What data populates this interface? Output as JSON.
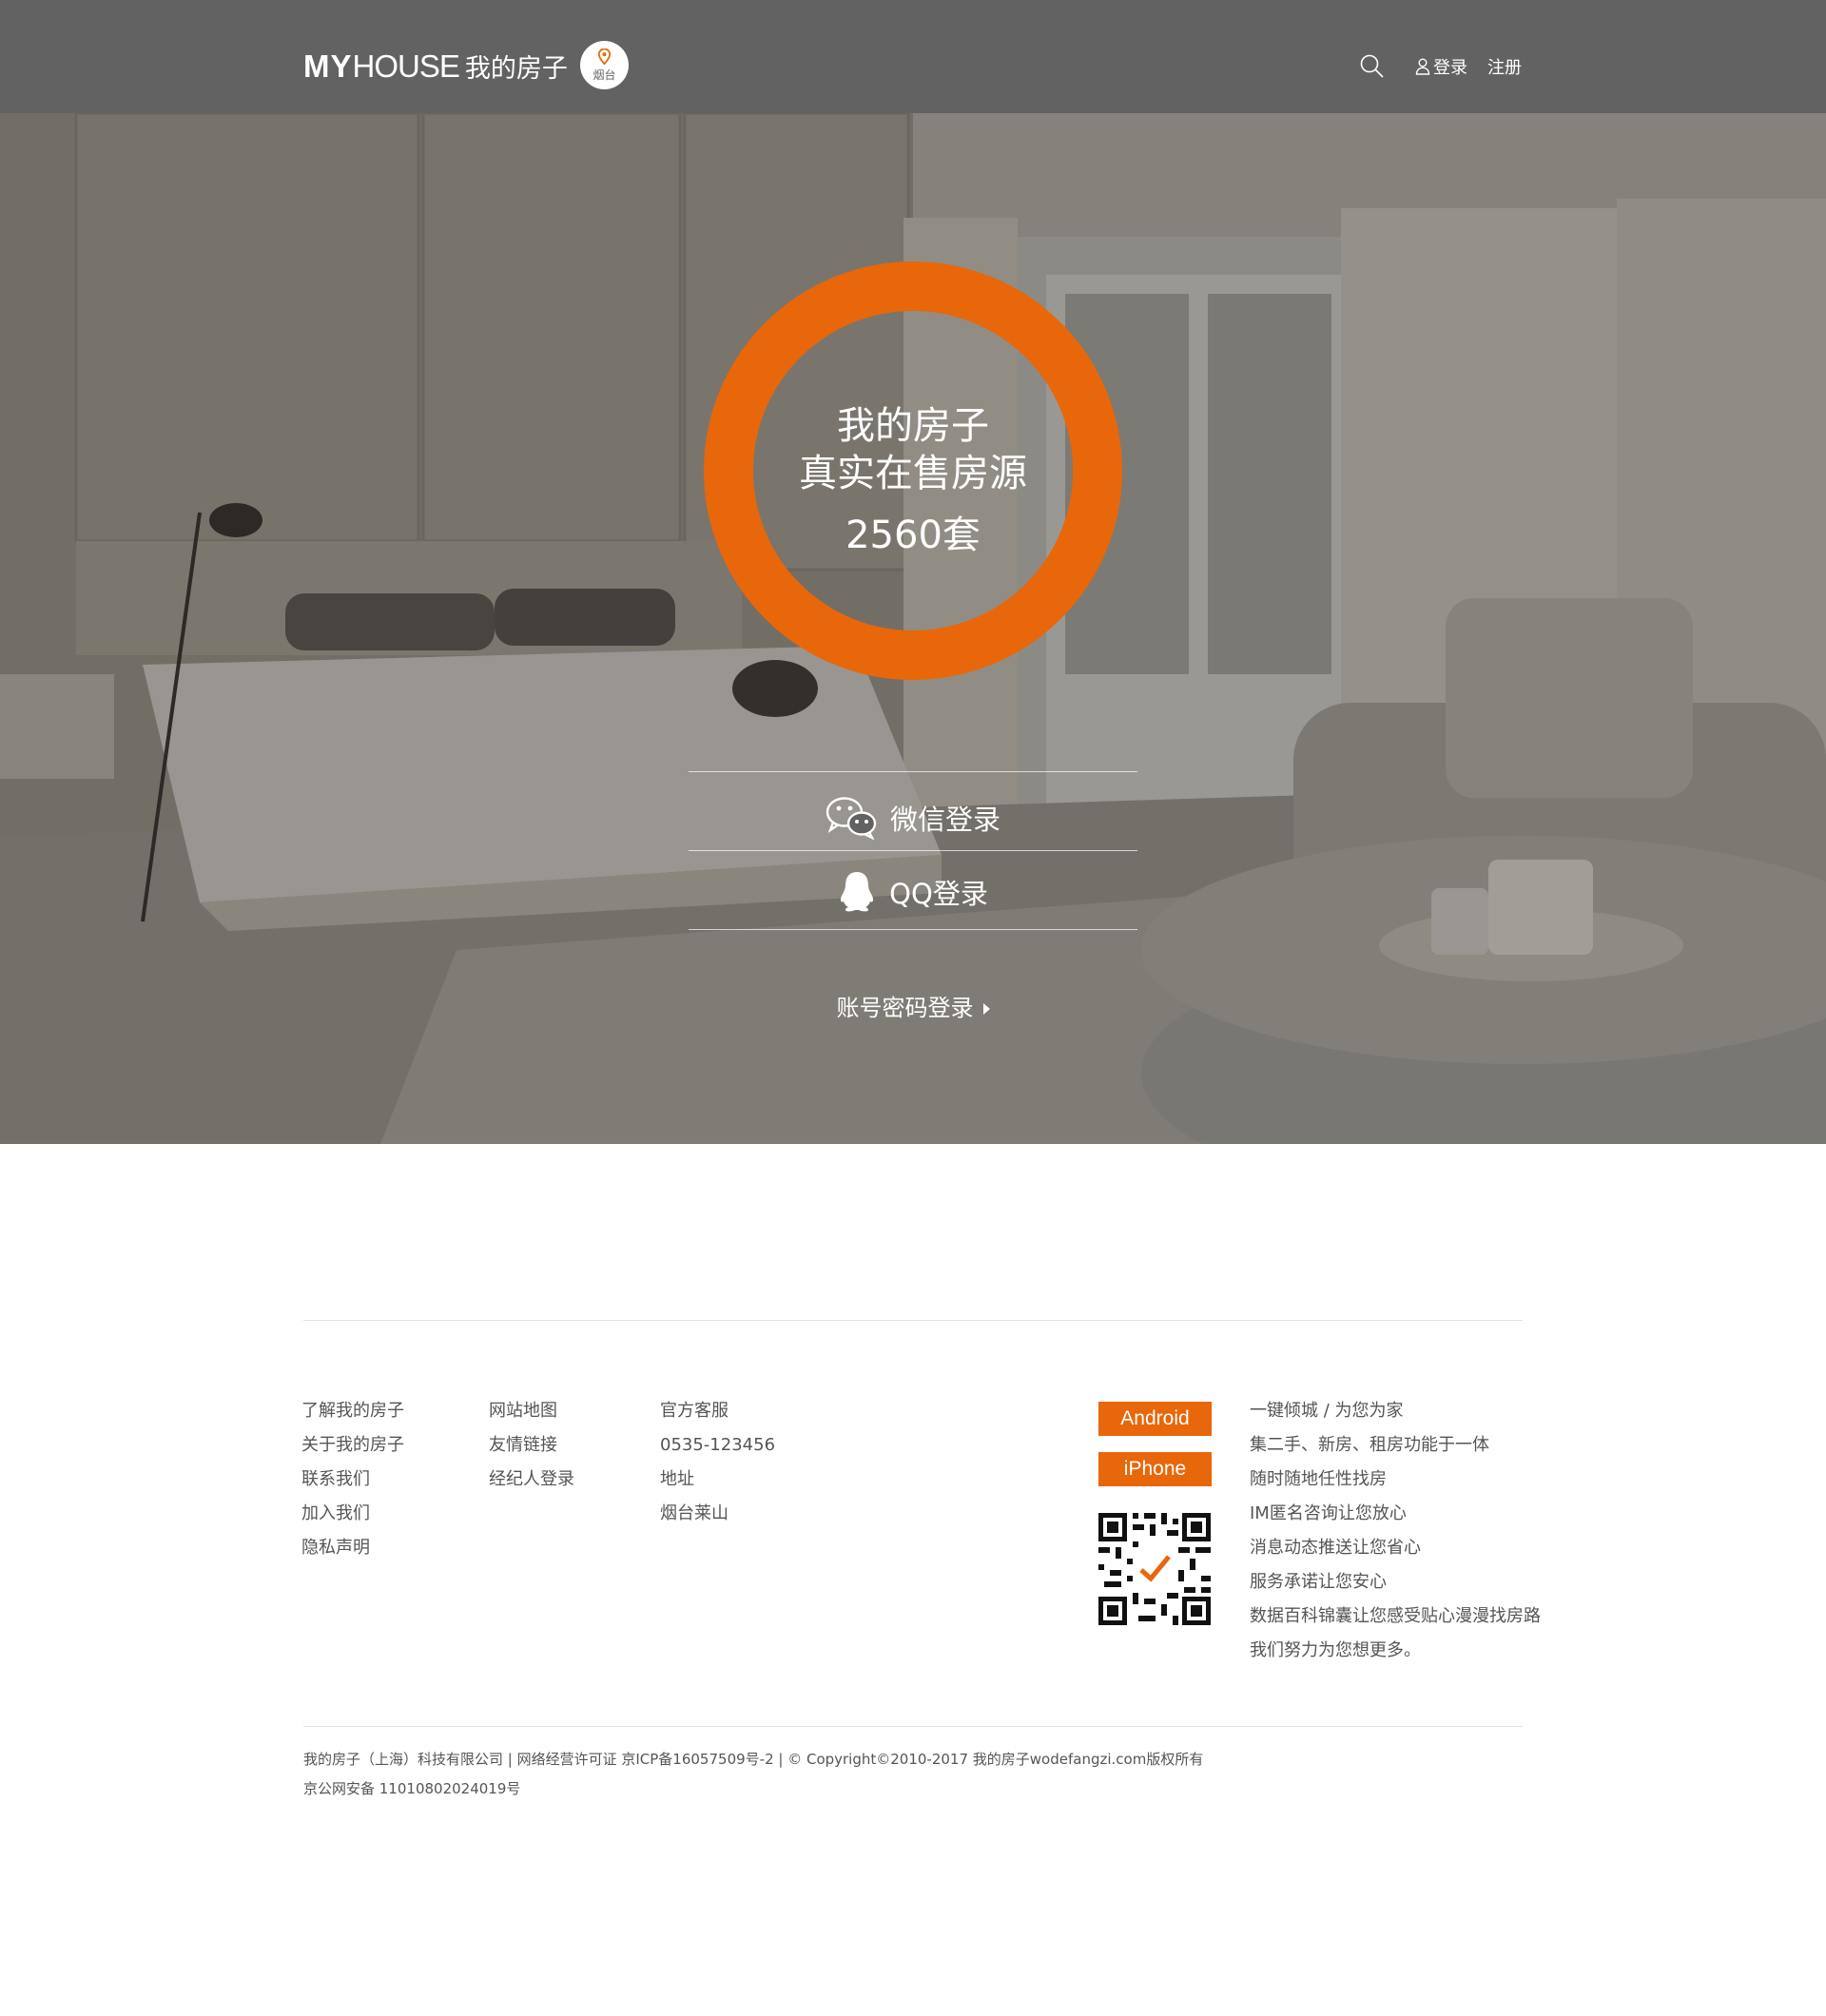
{
  "header": {
    "logo_my": "MY",
    "logo_house": "HOUSE",
    "logo_cn": "我的房子",
    "city": "烟台",
    "login": "登录",
    "register": "注册"
  },
  "hero": {
    "line1": "我的房子",
    "line2": "真实在售房源",
    "count": "2560套",
    "wechat_login": "微信登录",
    "qq_login": "QQ登录",
    "account_login": "账号密码登录"
  },
  "footer": {
    "col1": [
      "了解我的房子",
      "关于我的房子",
      "联系我们",
      "加入我们",
      "隐私声明"
    ],
    "col2": [
      "网站地图",
      "友情链接",
      "经纪人登录"
    ],
    "col3": [
      "官方客服",
      "0535-123456",
      "地址",
      "烟台莱山"
    ],
    "android": "Android",
    "iphone": "iPhone",
    "slogans": [
      "一键倾城 / 为您为家",
      "集二手、新房、租房功能于一体",
      "随时随地任性找房",
      "IM匿名咨询让您放心",
      "消息动态推送让您省心",
      "服务承诺让您安心",
      "数据百科锦囊让您感受贴心漫漫找房路",
      "我们努力为您想更多。"
    ],
    "copyright1": "我的房子（上海）科技有限公司 | 网络经营许可证 京ICP备16057509号-2 | © Copyright©2010-2017 我的房子wodefangzi.com版权所有",
    "copyright2": "京公网安备 11010802024019号"
  },
  "colors": {
    "accent": "#e8670a",
    "header_bg": "#626262"
  }
}
